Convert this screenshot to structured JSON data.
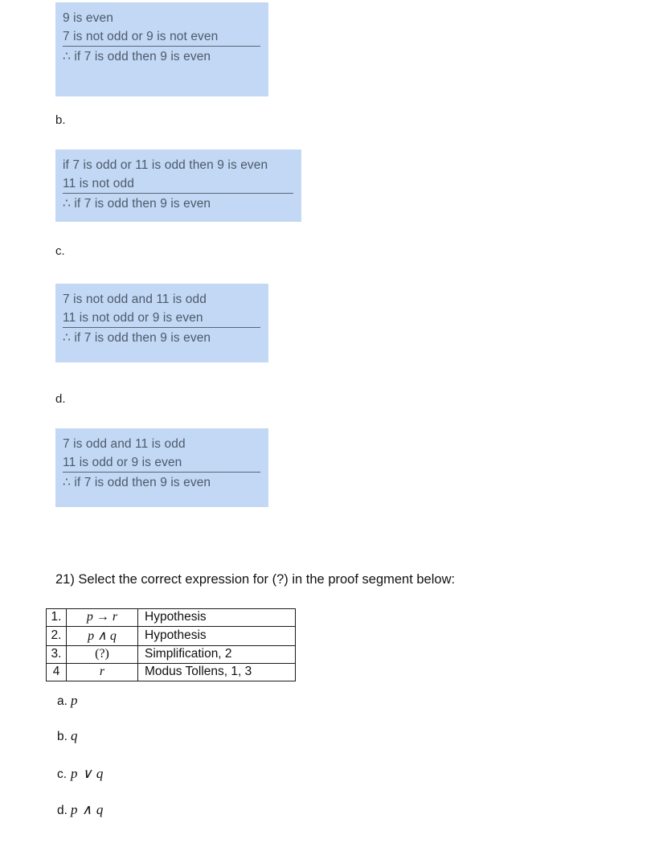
{
  "page": {
    "background": "#ffffff",
    "highlight_color": "#c2d8f4",
    "highlight_text_color": "#4d5a6b"
  },
  "arguments": [
    {
      "letter": "",
      "lines": [
        "9 is even",
        "7 is not odd or 9 is not even",
        "∴ if 7 is odd then 9 is even"
      ]
    },
    {
      "letter": "b.",
      "lines": [
        "if 7 is odd or 11 is odd then 9 is even",
        "11 is not odd",
        "∴ if 7 is odd then 9 is even"
      ]
    },
    {
      "letter": "c.",
      "lines": [
        "7 is not odd and 11 is odd",
        "11 is not odd or 9 is even",
        "∴ if 7 is odd then 9 is even"
      ]
    },
    {
      "letter": "d.",
      "lines": [
        "7 is odd and 11 is odd",
        "11 is odd or 9 is even",
        "∴ if 7 is odd then 9 is even"
      ]
    }
  ],
  "question21": {
    "prompt": "21) Select the correct expression for (?) in the proof segment below:",
    "table": {
      "rows": [
        {
          "num": "1.",
          "expr": "p → r",
          "reason": "Hypothesis"
        },
        {
          "num": "2.",
          "expr": "p ∧ q",
          "reason": "Hypothesis"
        },
        {
          "num": "3.",
          "expr": "(?)",
          "reason": "Simplification, 2"
        },
        {
          "num": "4",
          "expr": "r",
          "reason": "Modus Tollens, 1, 3"
        }
      ]
    },
    "choices": [
      {
        "letter": "a.",
        "expr": "p"
      },
      {
        "letter": "b.",
        "expr": "q"
      },
      {
        "letter": "c.",
        "expr": "p ∨ q"
      },
      {
        "letter": "d.",
        "expr": "p ∧ q"
      }
    ]
  }
}
